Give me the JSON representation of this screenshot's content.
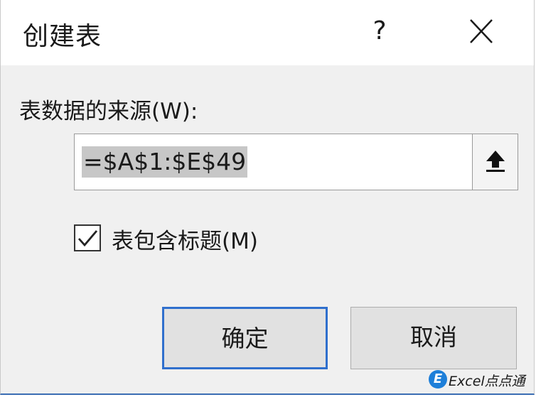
{
  "dialog": {
    "title": "创建表",
    "help_label": "?",
    "close_icon": "close-icon"
  },
  "source": {
    "label": "表数据的来源(W):",
    "range_value": "=$A$1:$E$49",
    "collapse_icon": "upload-arrow-icon"
  },
  "options": {
    "has_headers_label": "表包含标题(M)",
    "has_headers_checked": true
  },
  "buttons": {
    "ok_label": "确定",
    "cancel_label": "取消"
  },
  "watermark": {
    "logo_letter": "E",
    "text": "Excel点点通"
  },
  "colors": {
    "accent": "#2f6fcd",
    "selection": "#c7c7c7",
    "dialog_bg": "#f0f0f0"
  }
}
